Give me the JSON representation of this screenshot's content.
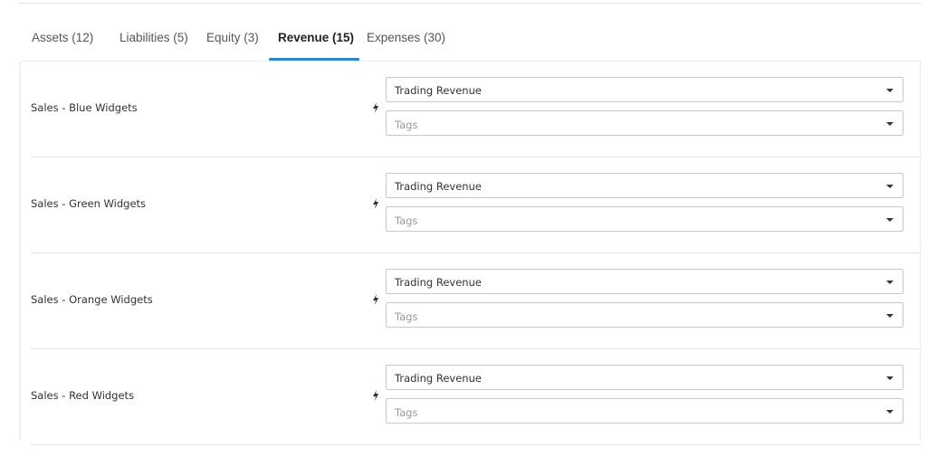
{
  "tabs": [
    {
      "label": "Assets (12)",
      "active": false
    },
    {
      "label": "Liabilities (5)",
      "active": false
    },
    {
      "label": "Equity (3)",
      "active": false
    },
    {
      "label": "Revenue (15)",
      "active": true
    },
    {
      "label": "Expenses (30)",
      "active": false
    }
  ],
  "rows": [
    {
      "account": "Sales - Blue Widgets",
      "type_value": "Trading Revenue",
      "tags_placeholder": "Tags"
    },
    {
      "account": "Sales - Green Widgets",
      "type_value": "Trading Revenue",
      "tags_placeholder": "Tags"
    },
    {
      "account": "Sales - Orange Widgets",
      "type_value": "Trading Revenue",
      "tags_placeholder": "Tags"
    },
    {
      "account": "Sales - Red Widgets",
      "type_value": "Trading Revenue",
      "tags_placeholder": "Tags"
    }
  ],
  "icons": {
    "row_indicator": "bolt-icon",
    "select_toggle": "chevron-down-icon"
  },
  "colors": {
    "active_tab_underline": "#2d86c7",
    "border": "#c9c9c9",
    "placeholder": "#9a9a9a"
  }
}
